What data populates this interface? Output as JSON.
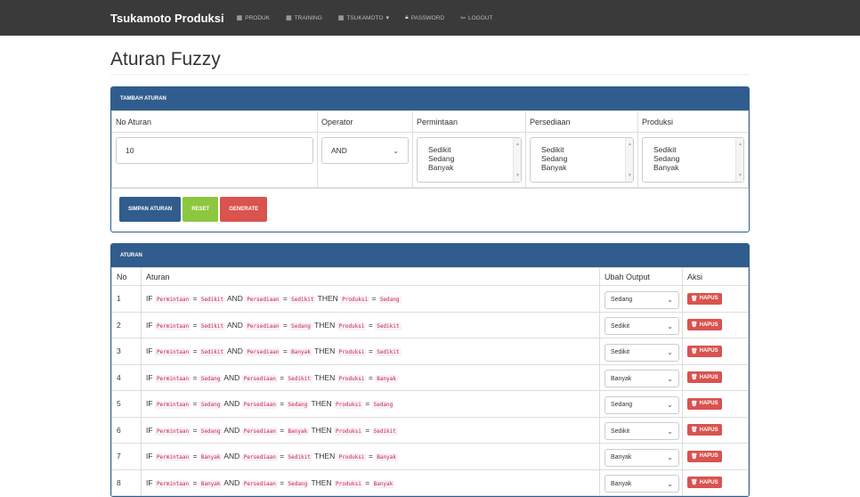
{
  "nav": {
    "brand": "Tsukamoto Produksi",
    "items": [
      {
        "icon": "grid-icon",
        "label": "PRODUK"
      },
      {
        "icon": "grid-icon",
        "label": "TRAINING"
      },
      {
        "icon": "grid-icon",
        "label": "TSUKAMOTO"
      },
      {
        "icon": "lock-icon",
        "label": "PASSWORD"
      },
      {
        "icon": "logout-icon",
        "label": "LOGOUT"
      }
    ]
  },
  "page": {
    "title": "Aturan Fuzzy"
  },
  "form": {
    "heading": "TAMBAH ATURAN",
    "columns": [
      "No Aturan",
      "Operator",
      "Permintaan",
      "Persediaan",
      "Produksi"
    ],
    "no_aturan_value": "10",
    "operator_value": "AND",
    "permintaan_options": [
      "Sedikit",
      "Sedang",
      "Banyak"
    ],
    "persediaan_options": [
      "Sedikit",
      "Sedang",
      "Banyak"
    ],
    "produksi_options": [
      "Sedikit",
      "Sedang",
      "Banyak"
    ],
    "buttons": {
      "save": "SIMPAN ATURAN",
      "reset": "RESET",
      "generate": "GENERATE"
    }
  },
  "rules": {
    "heading": "ATURAN",
    "columns": {
      "no": "No",
      "aturan": "Aturan",
      "output": "Ubah Output",
      "aksi": "Aksi"
    },
    "kw_if": "IF",
    "kw_and": "AND",
    "kw_then": "THEN",
    "var_permintaan": "Permintaan",
    "var_persediaan": "Persediaan",
    "var_produksi": "Produksi",
    "delete_label": "HAPUS",
    "rows": [
      {
        "no": "1",
        "permintaan": "Sedikit",
        "persediaan": "Sedikit",
        "produksi": "Sedang",
        "output": "Sedang"
      },
      {
        "no": "2",
        "permintaan": "Sedikit",
        "persediaan": "Sedang",
        "produksi": "Sedikit",
        "output": "Sedikit"
      },
      {
        "no": "3",
        "permintaan": "Sedikit",
        "persediaan": "Banyak",
        "produksi": "Sedikit",
        "output": "Sedikit"
      },
      {
        "no": "4",
        "permintaan": "Sedang",
        "persediaan": "Sedikit",
        "produksi": "Banyak",
        "output": "Banyak"
      },
      {
        "no": "5",
        "permintaan": "Sedang",
        "persediaan": "Sedang",
        "produksi": "Sedang",
        "output": "Sedang"
      },
      {
        "no": "6",
        "permintaan": "Sedang",
        "persediaan": "Banyak",
        "produksi": "Sedikit",
        "output": "Sedikit"
      },
      {
        "no": "7",
        "permintaan": "Banyak",
        "persediaan": "Sedikit",
        "produksi": "Banyak",
        "output": "Banyak"
      },
      {
        "no": "8",
        "permintaan": "Banyak",
        "persediaan": "Sedang",
        "produksi": "Banyak",
        "output": "Banyak"
      }
    ]
  }
}
